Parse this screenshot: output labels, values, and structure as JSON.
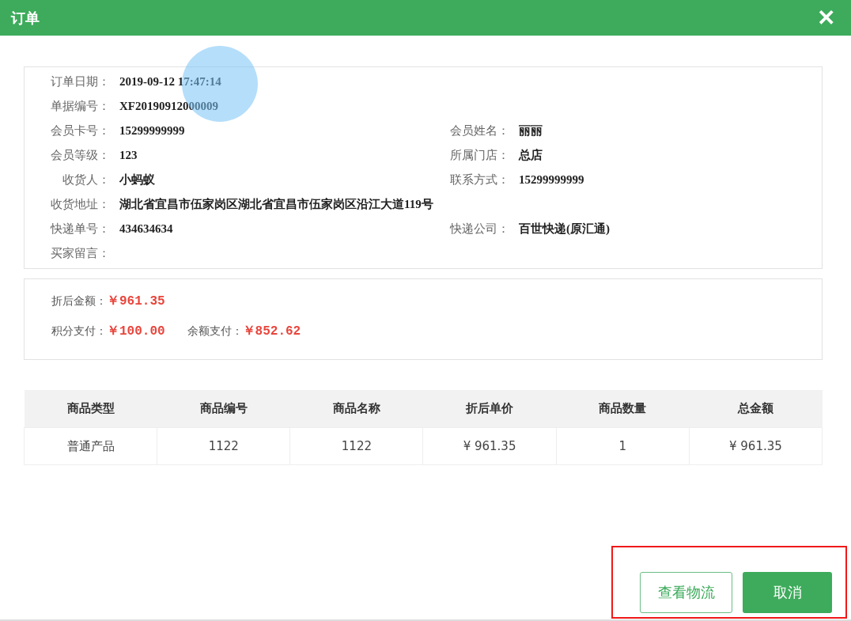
{
  "dialog": {
    "title": "订单",
    "close": "✕"
  },
  "order_info": {
    "rows": [
      {
        "fields": [
          {
            "label": "订单日期：",
            "value": "2019-09-12 17:47:14"
          }
        ]
      },
      {
        "fields": [
          {
            "label": "单据编号：",
            "value": "XF20190912000009"
          }
        ]
      },
      {
        "fields": [
          {
            "label": "会员卡号：",
            "value": "15299999999"
          },
          {
            "label": "会员姓名：",
            "value": "丽丽"
          }
        ]
      },
      {
        "fields": [
          {
            "label": "会员等级：",
            "value": "123"
          },
          {
            "label": "所属门店：",
            "value": "总店"
          }
        ]
      },
      {
        "fields": [
          {
            "label": "收货人：",
            "value": "小蚂蚁"
          },
          {
            "label": "联系方式：",
            "value": "15299999999"
          }
        ]
      },
      {
        "fields": [
          {
            "label": "收货地址：",
            "value": "湖北省宜昌市伍家岗区湖北省宜昌市伍家岗区沿江大道119号"
          }
        ]
      },
      {
        "fields": [
          {
            "label": "快递单号：",
            "value": "434634634"
          },
          {
            "label": "快递公司：",
            "value": "百世快递(原汇通)"
          }
        ]
      },
      {
        "fields": [
          {
            "label": "买家留言："
          }
        ]
      }
    ]
  },
  "payment": {
    "rows": [
      [
        {
          "label": "折后金额：",
          "value": "￥961.35"
        }
      ],
      [
        {
          "label": "积分支付：",
          "value": "￥100.00"
        },
        {
          "label": "余额支付：",
          "value": "￥852.62"
        }
      ]
    ]
  },
  "table": {
    "columns": [
      "商品类型",
      "商品编号",
      "商品名称",
      "折后单价",
      "商品数量",
      "总金额"
    ],
    "rows": [
      [
        "普通产品",
        "1122",
        "1122",
        "¥ 961.35",
        "1",
        "¥ 961.35"
      ]
    ]
  },
  "buttons": [
    {
      "label": "查看物流",
      "kind": "outline"
    },
    {
      "label": "取消",
      "kind": "primary"
    }
  ]
}
